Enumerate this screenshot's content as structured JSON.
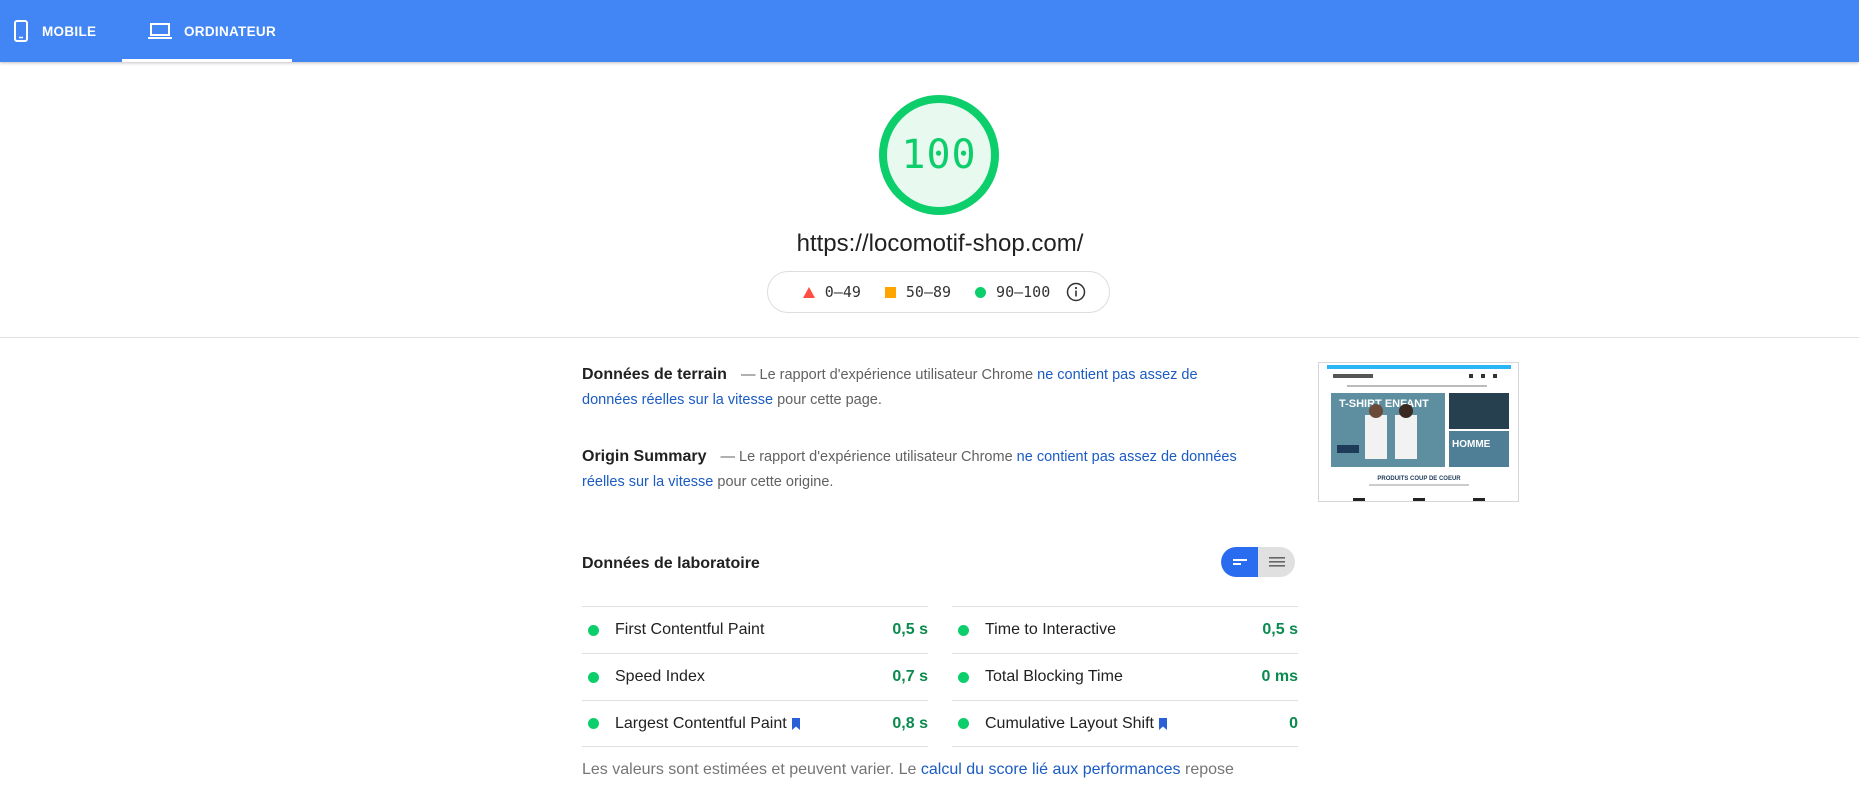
{
  "tabs": [
    {
      "label": "MOBILE",
      "icon": "smartphone-icon"
    },
    {
      "label": "ORDINATEUR",
      "icon": "laptop-icon",
      "active": true
    }
  ],
  "score": {
    "value": "100",
    "fraction": 1.0,
    "color": "#0cce6b"
  },
  "url": "https://locomotif-shop.com/",
  "legend": {
    "fail": "0–49",
    "average": "50–89",
    "pass": "90–100",
    "info_icon": "info-icon"
  },
  "field_data": {
    "title": "Données de terrain",
    "dash": "—",
    "text_before": "Le rapport d'expérience utilisateur Chrome",
    "link": "ne contient pas assez de données réelles sur la vitesse",
    "text_after": "pour cette page."
  },
  "origin_summary": {
    "title": "Origin Summary",
    "dash": "—",
    "text_before": "Le rapport d'expérience utilisateur Chrome",
    "link": "ne contient pas assez de données réelles sur la vitesse",
    "text_after": "pour cette origine."
  },
  "screenshot_thumbnail": {
    "headline": "T-SHIRT ENFANT",
    "side_label": "HOMME",
    "section_label": "PRODUITS COUP DE COEUR"
  },
  "lab_data": {
    "title": "Données de laboratoire",
    "metrics_left": [
      {
        "label": "First Contentful Paint",
        "value": "0,5 s"
      },
      {
        "label": "Speed Index",
        "value": "0,7 s"
      },
      {
        "label": "Largest Contentful Paint",
        "value": "0,8 s",
        "bookmark": true
      }
    ],
    "metrics_right": [
      {
        "label": "Time to Interactive",
        "value": "0,5 s"
      },
      {
        "label": "Total Blocking Time",
        "value": "0 ms"
      },
      {
        "label": "Cumulative Layout Shift",
        "value": "0",
        "bookmark": true
      }
    ]
  },
  "footnote": {
    "text_before": "Les valeurs sont estimées et peuvent varier. Le",
    "link": "calcul du score lié aux performances",
    "text_after": "repose"
  },
  "colors": {
    "header": "#4285f4",
    "pass": "#0cce6b",
    "average": "#ffa400",
    "fail": "#ff4e42",
    "link": "#1a5bc4"
  }
}
